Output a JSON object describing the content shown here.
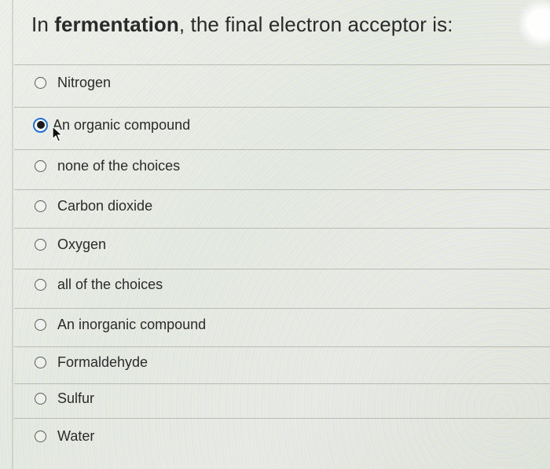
{
  "question": {
    "prefix": "In ",
    "emphasis": "fermentation",
    "suffix": ", the final electron acceptor is:"
  },
  "options": [
    {
      "label": "Nitrogen",
      "selected": false
    },
    {
      "label": "An organic compound",
      "selected": true
    },
    {
      "label": "none of the choices",
      "selected": false
    },
    {
      "label": "Carbon dioxide",
      "selected": false
    },
    {
      "label": "Oxygen",
      "selected": false
    },
    {
      "label": "all of the choices",
      "selected": false
    },
    {
      "label": "An inorganic compound",
      "selected": false
    },
    {
      "label": "Formaldehyde",
      "selected": false
    },
    {
      "label": "Sulfur",
      "selected": false
    },
    {
      "label": "Water",
      "selected": false
    }
  ],
  "colors": {
    "selected_ring": "#1f6fd6",
    "text": "#2b2b2b"
  },
  "icons": {
    "cursor": "mouse-pointer-icon"
  }
}
